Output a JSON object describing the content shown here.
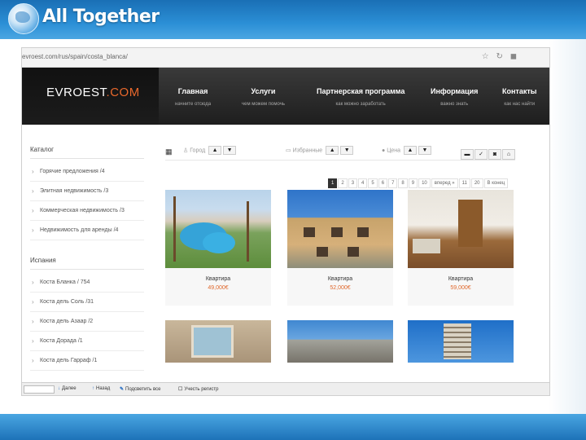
{
  "slide": {
    "brand": "All Together"
  },
  "browser": {
    "address": "evroest.com/rus/spain/costa_blanca/",
    "addr_icons": [
      "star-icon",
      "reload-icon",
      "addon-icon"
    ]
  },
  "site": {
    "logo_main": "EVROEST",
    "logo_accent": ".COM",
    "nav": [
      {
        "title": "Главная",
        "subtitle": "начните отсюда"
      },
      {
        "title": "Услуги",
        "subtitle": "чем можем помочь"
      },
      {
        "title": "Партнерская программа",
        "subtitle": "как можно заработать"
      },
      {
        "title": "Информация",
        "subtitle": "важно знать"
      },
      {
        "title": "Контакты",
        "subtitle": "как нас найти"
      }
    ],
    "sidebar": {
      "catalog_title": "Каталог",
      "catalog_items": [
        "Горячие предложения /4",
        "Элитная недвижимость /3",
        "Коммерческая недвижимость /3",
        "Недвижимость для аренды /4"
      ],
      "spain_title": "Испания",
      "spain_items": [
        "Коста Бланка / 754",
        "Коста дель Соль /31",
        "Коста дель Азаар /2",
        "Коста Дорада /1",
        "Коста дель Гарраф /1"
      ]
    },
    "toolbar": {
      "sort_city": "Город",
      "sort_favorites": "Избранные",
      "sort_price": "Цена",
      "up": "▲",
      "down": "▼",
      "grid_icon": "grid-icon",
      "right_icons": [
        "list-icon",
        "check-icon",
        "camera-icon",
        "home-icon"
      ]
    },
    "pager": {
      "pages": [
        "1",
        "2",
        "3",
        "4",
        "5",
        "6",
        "7",
        "8",
        "9",
        "10"
      ],
      "active": "1",
      "next": "вперед »",
      "extra": [
        "11",
        "20"
      ],
      "all": "В конец"
    },
    "cards": [
      {
        "title": "Квартира",
        "price": "49,000€"
      },
      {
        "title": "Квартира",
        "price": "52,000€"
      },
      {
        "title": "Квартира",
        "price": "59,000€"
      },
      {
        "title": "",
        "price": ""
      },
      {
        "title": "",
        "price": ""
      },
      {
        "title": "",
        "price": ""
      }
    ]
  },
  "findbar": {
    "next": "Далее",
    "prev": "Назад",
    "highlight": "Подсветить все",
    "match_case": "Учесть регистр"
  }
}
